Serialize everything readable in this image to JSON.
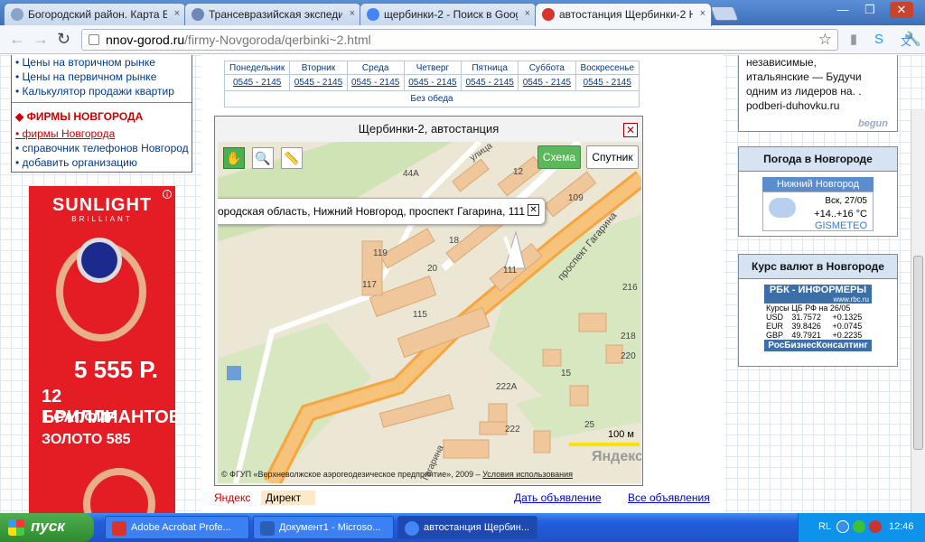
{
  "browser": {
    "tabs": [
      {
        "title": "Богородский район. Карта Б",
        "icon_color": "#8aa4c8"
      },
      {
        "title": "Трансевразийская экспедиц",
        "icon_color": "#6f86b6"
      },
      {
        "title": "щербинки-2 - Поиск в Google",
        "icon_color": "#4285f4"
      },
      {
        "title": "автостанция Щербинки-2 Ни",
        "icon_color": "#d9342b"
      }
    ],
    "close_glyph": "×",
    "address_host": "nnov-gorod.ru",
    "address_path": "/firmy-Novgoroda/qerbinki~2.html",
    "window_controls": [
      "—",
      "❐",
      "✕"
    ],
    "toolbar_icons": [
      "star-icon",
      "bar-chart-icon",
      "skype-icon",
      "translate-icon",
      "wrench-icon"
    ]
  },
  "left": {
    "links_top": [
      "Цены на вторичном рынке",
      "Цены на первичном рынке",
      "Калькулятор продажи квартир"
    ],
    "section_title": "ФИРМЫ НОВГОРОДА",
    "links_bottom": [
      "фирмы Новгорода",
      "справочник телефонов Новгород",
      "добавить организацию"
    ],
    "ad": {
      "brand": "SUNLIGHT",
      "sub": "BRILLIANT",
      "price": "5 555 Р.",
      "line1": "12 БРИЛЛИАНТОВ",
      "line2": "1 САПФИР",
      "line3": "ЗОЛОТО 585",
      "info": "i"
    }
  },
  "schedule": {
    "days": [
      "Понедельник",
      "Вторник",
      "Среда",
      "Четверг",
      "Пятница",
      "Суббота",
      "Воскресенье"
    ],
    "hours": [
      "0545 - 2145",
      "0545 - 2145",
      "0545 - 2145",
      "0545 - 2145",
      "0545 - 2145",
      "0545 - 2145",
      "0545 - 2145"
    ],
    "lunch": "Без обеда"
  },
  "map": {
    "title": "Щербинки-2, автостанция",
    "tools": [
      "hand-icon",
      "zoom-icon",
      "ruler-icon"
    ],
    "schema_btn": "Схема",
    "sputnik_btn": "Спутник",
    "balloon": "ородская область, Нижний Новгород, проспект Гагарина, 111",
    "street1": "улица",
    "street2": "проспект Гагарина",
    "street3": "Гагарина",
    "numbers": [
      "44А",
      "12",
      "109",
      "18",
      "119",
      "20",
      "117",
      "111",
      "115",
      "216",
      "222А",
      "222",
      "25",
      "220",
      "218",
      "15"
    ],
    "scale": "100 м",
    "logo": "Яндекс",
    "copyright": "© ФГУП «Верхневолжское аэрогеодезическое предприятие», 2009 – ",
    "terms": "Условия использования"
  },
  "bottom": {
    "yandex": "Яндекс",
    "direct": "Директ",
    "give_ad": "Дать объявление",
    "all_ads": "Все объявления"
  },
  "right": {
    "ad_lines": [
      "независимые,",
      "итальянские — Будучи",
      "одним из лидеров на. .",
      "podberi-duhovku.ru"
    ],
    "begun": "begun",
    "weather": {
      "title": "Погода в Новгороде",
      "city": "Нижний Новгород",
      "date": "Вск, 27/05",
      "temp": "+14..+16 °С",
      "brand": "GISMETEO"
    },
    "currency": {
      "title": "Курс валют в Новгороде",
      "brand": "РБК - ИНФОРМЕРЫ",
      "url": "www.rbc.ru",
      "caption": "Курсы ЦБ РФ на 26/05",
      "rows": [
        [
          "USD",
          "31.7572",
          "+0.1325"
        ],
        [
          "EUR",
          "39.8426",
          "+0.0745"
        ],
        [
          "GBP",
          "49.7921",
          "+0.2235"
        ]
      ],
      "footer": "РосБизнесКонсалтинг"
    }
  },
  "taskbar": {
    "start": "пуск",
    "tasks": [
      {
        "title": "Adobe Acrobat Profe...",
        "icon_color": "#d9342b"
      },
      {
        "title": "Документ1 - Microso...",
        "icon_color": "#2b5fb6"
      },
      {
        "title": "автостанция Щербин...",
        "icon_color": "#4285f4"
      }
    ],
    "lang": "RL",
    "time": "12:46"
  }
}
